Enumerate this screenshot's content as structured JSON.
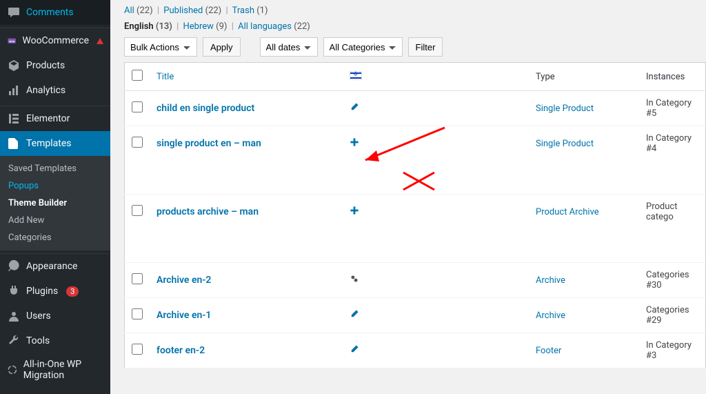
{
  "sidebar": {
    "items": [
      {
        "id": "comments",
        "label": "Comments"
      },
      {
        "id": "woocommerce",
        "label": "WooCommerce"
      },
      {
        "id": "products",
        "label": "Products"
      },
      {
        "id": "analytics",
        "label": "Analytics"
      },
      {
        "id": "elementor",
        "label": "Elementor"
      },
      {
        "id": "templates",
        "label": "Templates"
      },
      {
        "id": "appearance",
        "label": "Appearance"
      },
      {
        "id": "plugins",
        "label": "Plugins"
      },
      {
        "id": "users",
        "label": "Users"
      },
      {
        "id": "tools",
        "label": "Tools"
      },
      {
        "id": "aiowp",
        "label": "All-in-One WP Migration"
      }
    ],
    "plugins_badge": "3",
    "submenu": [
      {
        "label": "Saved Templates",
        "cls": ""
      },
      {
        "label": "Popups",
        "cls": "active"
      },
      {
        "label": "Theme Builder",
        "cls": "bold"
      },
      {
        "label": "Add New",
        "cls": ""
      },
      {
        "label": "Categories",
        "cls": ""
      }
    ]
  },
  "filters_status": [
    {
      "label": "All",
      "count": "(22)",
      "cls": "link"
    },
    {
      "label": "Published",
      "count": "(22)",
      "cls": "link"
    },
    {
      "label": "Trash",
      "count": "(1)",
      "cls": "link"
    }
  ],
  "filters_lang": [
    {
      "label": "English",
      "count": "(13)",
      "cls": "current"
    },
    {
      "label": "Hebrew",
      "count": "(9)",
      "cls": "link"
    },
    {
      "label": "All languages",
      "count": "(22)",
      "cls": "link"
    }
  ],
  "bulk": {
    "label": "Bulk Actions",
    "apply": "Apply"
  },
  "date_filter": "All dates",
  "cat_filter": "All Categories",
  "filter_btn": "Filter",
  "headers": {
    "title": "Title",
    "type": "Type",
    "instances": "Instances"
  },
  "rows": [
    {
      "title": "child en single product",
      "icon": "pencil",
      "type": "Single Product",
      "inst": "In Category #5",
      "tall": false
    },
    {
      "title": "single product en – man",
      "icon": "plus",
      "type": "Single Product",
      "inst": "In Category #4",
      "tall": true
    },
    {
      "title": "products archive – man",
      "icon": "plus",
      "type": "Product Archive",
      "inst": "Product catego",
      "tall": true
    },
    {
      "title": "Archive en-2",
      "icon": "gear",
      "type": "Archive",
      "inst": "Categories #30",
      "tall": false
    },
    {
      "title": "Archive en-1",
      "icon": "pencil",
      "type": "Archive",
      "inst": "Categories #29",
      "tall": false
    },
    {
      "title": "footer en-2",
      "icon": "pencil",
      "type": "Footer",
      "inst": "In Category #3",
      "tall": false
    }
  ]
}
